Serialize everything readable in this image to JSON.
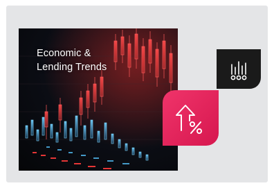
{
  "card": {
    "title": "Economic &\nLending Trends"
  },
  "icons": {
    "black_tile_icon": "bar-chart-coins-icon",
    "pink_tile_icon": "arrow-up-percent-icon"
  },
  "colors": {
    "frame_background": "#e4e5e7",
    "accent_pink": "#e62a5e",
    "tile_black": "#1a1a1a",
    "chart_red": "#ff3b3b",
    "chart_blue": "#4fb3e8"
  }
}
